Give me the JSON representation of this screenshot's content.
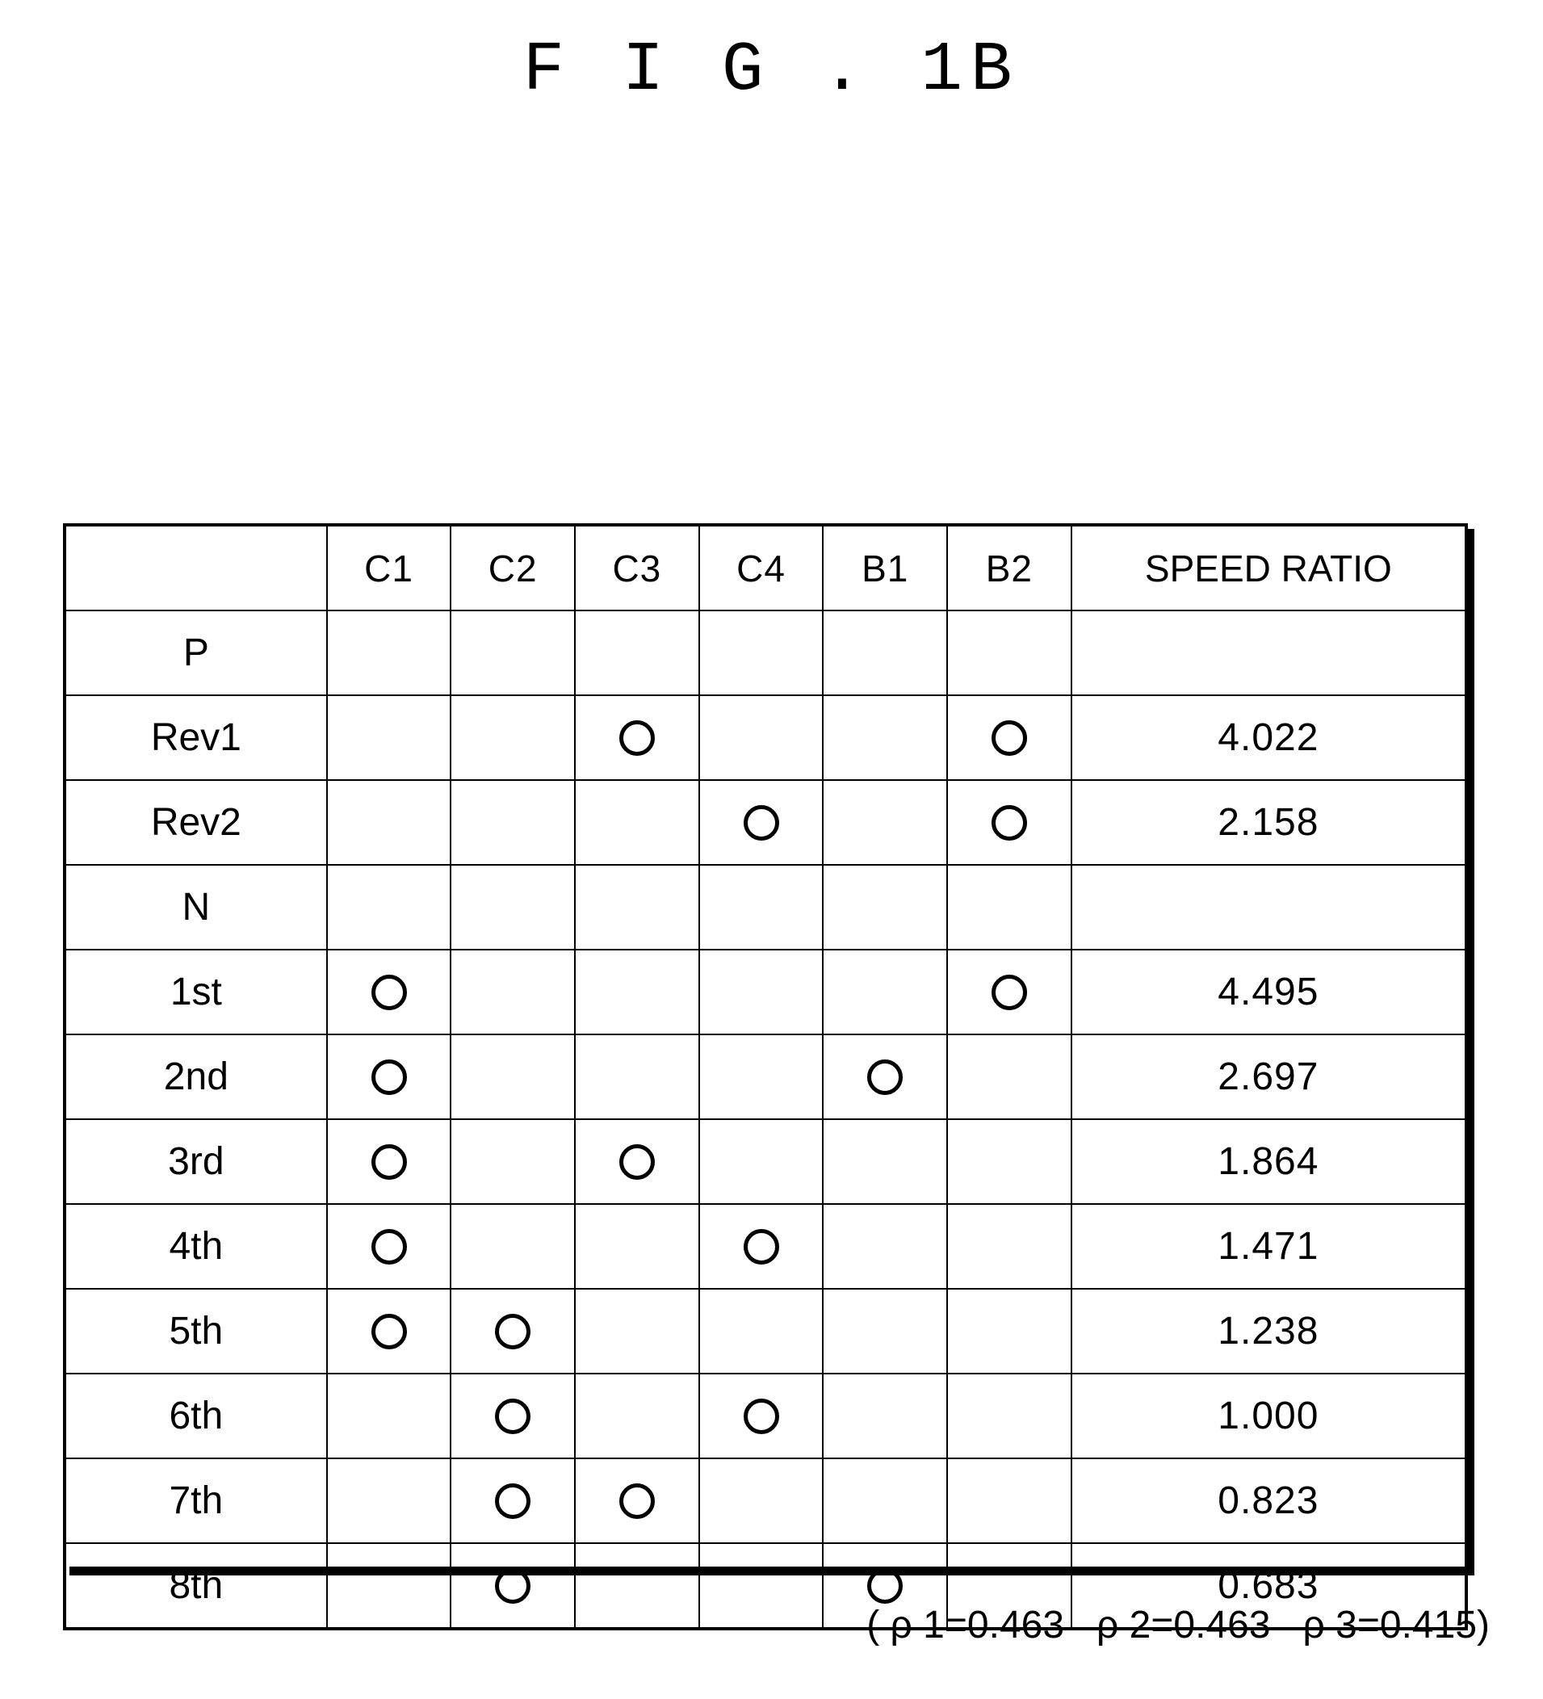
{
  "figure": {
    "title": "F I G . 1B"
  },
  "table": {
    "columns": [
      {
        "key": "label",
        "label": ""
      },
      {
        "key": "C1",
        "label": "C1"
      },
      {
        "key": "C2",
        "label": "C2"
      },
      {
        "key": "C3",
        "label": "C3"
      },
      {
        "key": "C4",
        "label": "C4"
      },
      {
        "key": "B1",
        "label": "B1"
      },
      {
        "key": "B2",
        "label": "B2"
      },
      {
        "key": "ratio",
        "label": "SPEED RATIO"
      }
    ],
    "mark_symbol": "circle",
    "rows": [
      {
        "label": "P",
        "C1": "",
        "C2": "",
        "C3": "",
        "C4": "",
        "B1": "",
        "B2": "",
        "ratio": ""
      },
      {
        "label": "Rev1",
        "C1": "",
        "C2": "",
        "C3": "O",
        "C4": "",
        "B1": "",
        "B2": "O",
        "ratio": "4.022"
      },
      {
        "label": "Rev2",
        "C1": "",
        "C2": "",
        "C3": "",
        "C4": "O",
        "B1": "",
        "B2": "O",
        "ratio": "2.158"
      },
      {
        "label": "N",
        "C1": "",
        "C2": "",
        "C3": "",
        "C4": "",
        "B1": "",
        "B2": "",
        "ratio": ""
      },
      {
        "label": "1st",
        "C1": "O",
        "C2": "",
        "C3": "",
        "C4": "",
        "B1": "",
        "B2": "O",
        "ratio": "4.495"
      },
      {
        "label": "2nd",
        "C1": "O",
        "C2": "",
        "C3": "",
        "C4": "",
        "B1": "O",
        "B2": "",
        "ratio": "2.697"
      },
      {
        "label": "3rd",
        "C1": "O",
        "C2": "",
        "C3": "O",
        "C4": "",
        "B1": "",
        "B2": "",
        "ratio": "1.864"
      },
      {
        "label": "4th",
        "C1": "O",
        "C2": "",
        "C3": "",
        "C4": "O",
        "B1": "",
        "B2": "",
        "ratio": "1.471"
      },
      {
        "label": "5th",
        "C1": "O",
        "C2": "O",
        "C3": "",
        "C4": "",
        "B1": "",
        "B2": "",
        "ratio": "1.238"
      },
      {
        "label": "6th",
        "C1": "",
        "C2": "O",
        "C3": "",
        "C4": "O",
        "B1": "",
        "B2": "",
        "ratio": "1.000"
      },
      {
        "label": "7th",
        "C1": "",
        "C2": "O",
        "C3": "O",
        "C4": "",
        "B1": "",
        "B2": "",
        "ratio": "0.823"
      },
      {
        "label": "8th",
        "C1": "",
        "C2": "O",
        "C3": "",
        "C4": "",
        "B1": "O",
        "B2": "",
        "ratio": "0.683"
      }
    ]
  },
  "footnote": {
    "text": "( ρ 1=0.463   ρ 2=0.463   ρ 3=0.415)"
  },
  "colors": {
    "ink": "#000000",
    "paper": "#ffffff"
  }
}
